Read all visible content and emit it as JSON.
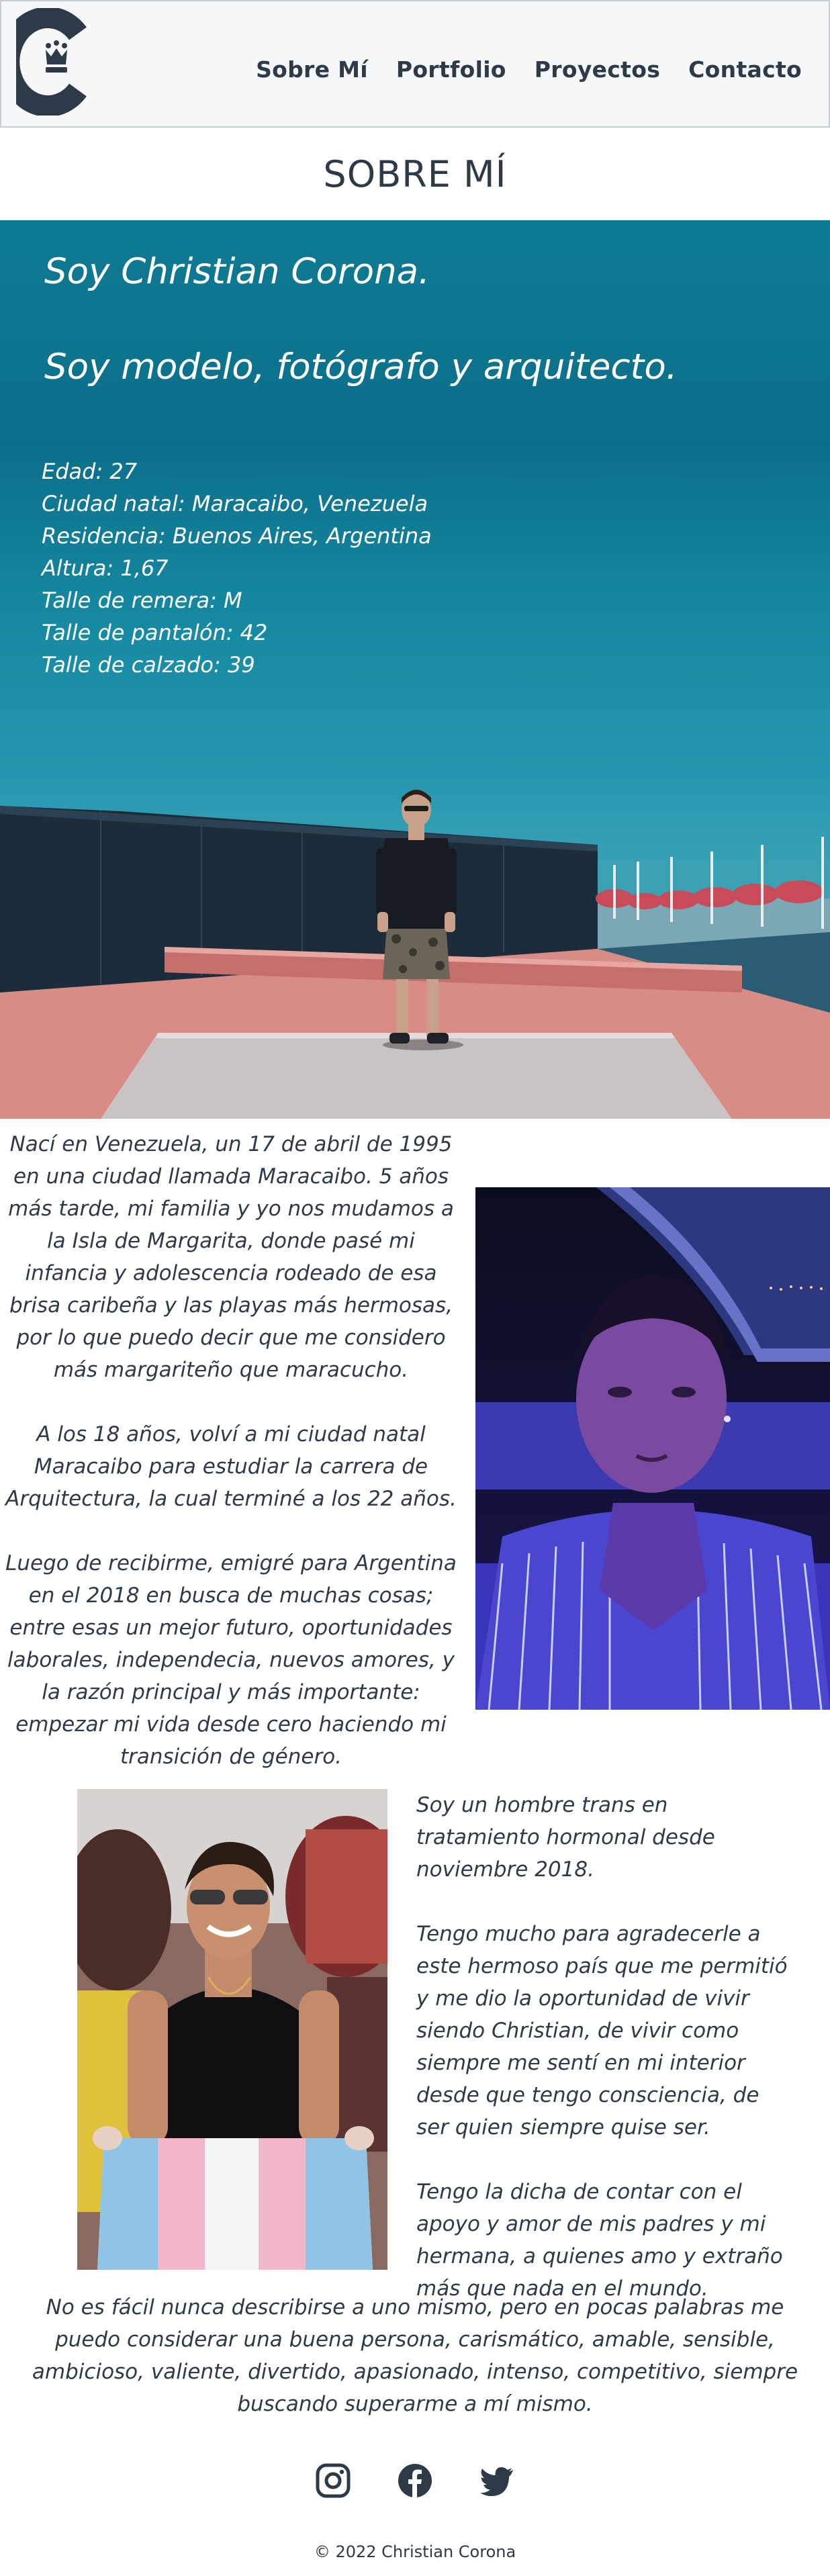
{
  "header": {
    "logo_icon": "crown-c-logo",
    "nav": [
      {
        "label": "Sobre Mí"
      },
      {
        "label": "Portfolio"
      },
      {
        "label": "Proyectos"
      },
      {
        "label": "Contacto"
      }
    ]
  },
  "page": {
    "title": "SOBRE MÍ"
  },
  "hero": {
    "line1": "Soy Christian Corona.",
    "line2": "Soy modelo, fotógrafo y arquitecto.",
    "facts": [
      "Edad: 27",
      "Ciudad natal: Maracaibo, Venezuela",
      "Residencia: Buenos Aires, Argentina",
      "Altura: 1,67",
      "Talle de remera: M",
      "Talle de pantalón: 42",
      "Talle de calzado: 39"
    ]
  },
  "story": {
    "p1": "Nací en Venezuela, un 17 de abril de 1995 en una ciudad llamada Maracaibo. 5 años más tarde, mi familia y yo nos mudamos a la Isla de Margarita, donde pasé mi infancia y adolescencia rodeado de esa brisa caribeña y las playas más hermosas, por lo que puedo decir que me considero más margariteño que maracucho.",
    "p2": "A los 18 años, volví a mi ciudad natal Maracaibo para estudiar la carrera de Arquitectura, la cual terminé a los 22 años.",
    "p3": "Luego de recibirme, emigré para Argentina en el 2018 en busca de muchas cosas; entre esas un mejor futuro, oportunidades laborales, independecia, nuevos amores, y la razón principal y más importante: empezar mi vida desde cero haciendo mi transición de género.",
    "p4": "Soy un hombre trans en tratamiento hormonal desde noviembre 2018.",
    "p5": "Tengo mucho para agradecerle a este hermoso país que me permitió y me dio la oportunidad de vivir siendo Christian, de vivir como siempre me sentí en mi interior desde que tengo consciencia, de ser quien siempre quise ser.",
    "p6": "Tengo la dicha de contar con el apoyo y amor de mis padres y mi hermana, a quienes amo y extraño más que nada en el mundo.",
    "closing": "No es fácil nunca describirse a uno mismo, pero en pocas palabras me puedo considerar una buena persona, carismático, amable, sensible, ambicioso, valiente, divertido, apasionado, intenso, competitivo, siempre buscando superarme a mí mismo."
  },
  "social": {
    "icons": [
      "instagram-icon",
      "facebook-icon",
      "twitter-icon"
    ]
  },
  "footer": {
    "copyright": "© 2022 Christian Corona"
  },
  "colors": {
    "text": "#2e3a47",
    "hero_teal": "#0e7b93",
    "header_bg": "#f6f7f8"
  }
}
